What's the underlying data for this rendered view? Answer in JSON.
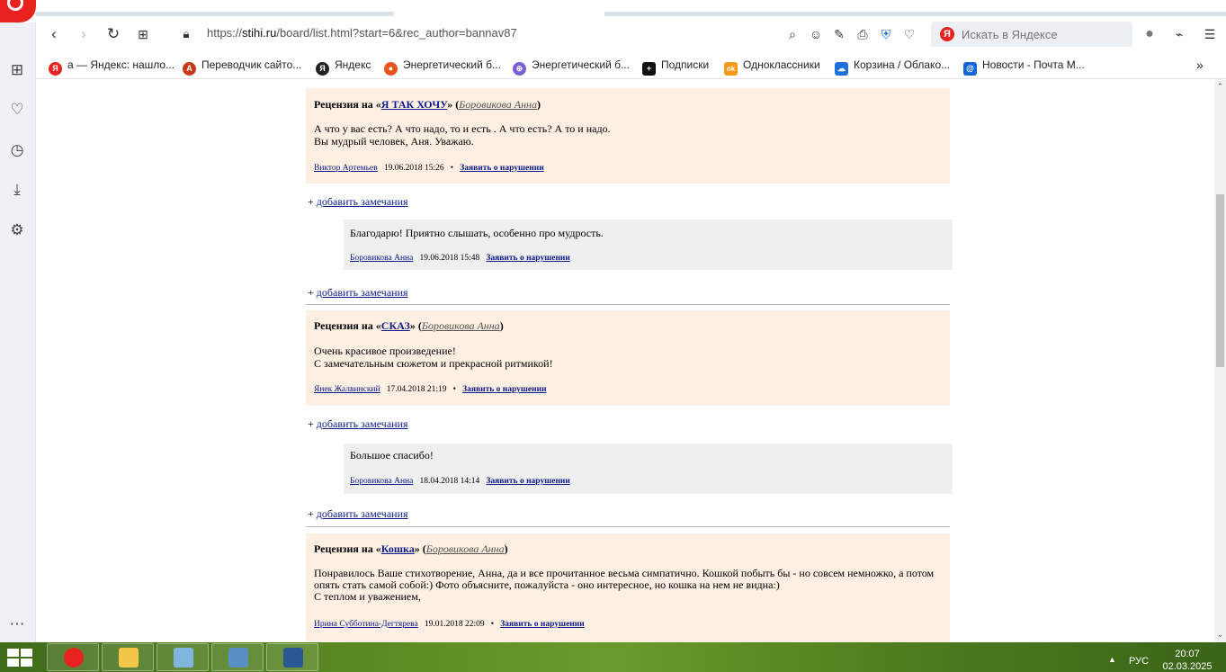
{
  "browser": {
    "url_prefix": "https://",
    "url_domain": "stihi.ru",
    "url_path": "/board/list.html?start=6&rec_author=bannav87",
    "search_placeholder": "Искать в Яндексе",
    "search_logo": "Я"
  },
  "bookmarks": [
    {
      "label": "а — Яндекс: нашло...",
      "icon": "yandex-icon",
      "color": "#e8231f",
      "glyph": "Я"
    },
    {
      "label": "Переводчик сайто...",
      "icon": "translator-icon",
      "color": "#c6391b",
      "glyph": "A"
    },
    {
      "label": "Яндекс",
      "icon": "yandex-icon",
      "color": "#222222",
      "glyph": "Я"
    },
    {
      "label": "Энергетический б...",
      "icon": "location-icon",
      "color": "#e8531f",
      "glyph": "●"
    },
    {
      "label": "Энергетический б...",
      "icon": "globe-icon",
      "color": "#7a5cd6",
      "glyph": "⊕"
    },
    {
      "label": "Подписки",
      "icon": "plus-icon",
      "color": "#111111",
      "glyph": "+"
    },
    {
      "label": "Одноклассники",
      "icon": "ok-icon",
      "color": "#f59a14",
      "glyph": "ok"
    },
    {
      "label": "Корзина / Облако...",
      "icon": "cloud-icon",
      "color": "#1e6fe0",
      "glyph": "☁"
    },
    {
      "label": "Новости - Почта М...",
      "icon": "mail-icon",
      "color": "#1565d8",
      "glyph": "@"
    }
  ],
  "page": {
    "add_note_prefix": "+ ",
    "add_note_label": "добавить замечания",
    "report_label": "Заявить о нарушении",
    "review_prefix": "Рецензия на «",
    "review_mid": "» (",
    "review_suffix": ")",
    "reviews": [
      {
        "work": "Я ТАК ХОЧУ",
        "author": "Боровикова Анна",
        "lines": [
          "А что у вас есть? А что надо, то и есть . А что есть? А то и надо.",
          "Вы мудрый человек, Аня. Уважаю."
        ],
        "reviewer": "Виктор Артемьев",
        "datetime": "19.06.2018 15:26",
        "reply": {
          "text": "Благодарю! Приятно слышать, особенно про мудрость.",
          "author": "Боровикова Анна",
          "datetime": "19.06.2018 15:48"
        }
      },
      {
        "work": "СКАЗ",
        "author": "Боровикова Анна",
        "lines": [
          "Очень красивое произведение!",
          "С замечательным сюжетом и прекрасной ритмикой!"
        ],
        "reviewer": "Янек Жалвинский",
        "datetime": "17.04.2018 21:19",
        "reply": {
          "text": "Большое спасибо!",
          "author": "Боровикова Анна",
          "datetime": "18.04.2018 14:14"
        }
      },
      {
        "work": "Кошка",
        "author": "Боровикова Анна",
        "lines": [
          "Понравилось Ваше стихотворение, Анна, да и все прочитанное весьма симпатично. Кошкой побыть бы - но совсем немножко, а потом",
          "опять стать самой собой:) Фото объясните, пожалуйста - оно интересное, но кошка на нем не видна:)",
          "С теплом и уважением,"
        ],
        "reviewer": "Ирина Субботина-Дегтярева",
        "datetime": "19.01.2018 22:09"
      }
    ]
  },
  "taskbar": {
    "language": "РУС",
    "time": "20:07",
    "date": "02.03.2025",
    "apps": [
      {
        "name": "opera",
        "color": "#e8231f"
      },
      {
        "name": "file-explorer",
        "color": "#f3c64a"
      },
      {
        "name": "notepad",
        "color": "#7fb6dd"
      },
      {
        "name": "photo-viewer",
        "color": "#5a8fc4"
      },
      {
        "name": "word",
        "color": "#2b5797"
      }
    ]
  }
}
